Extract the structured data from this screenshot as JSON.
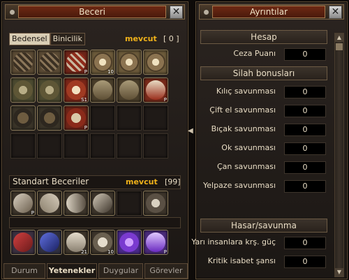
{
  "left_window": {
    "title": "Beceri",
    "close": "✕",
    "tabs": [
      "Bedensel",
      "Binicilik"
    ],
    "skills_section": {
      "available_label": "mevcut",
      "available_count": "[ 0 ]"
    },
    "skill_slots": [
      {
        "icon": "slash-icon",
        "badge": ""
      },
      {
        "icon": "slash-icon",
        "badge": ""
      },
      {
        "icon": "spiral-red-icon",
        "badge": "P"
      },
      {
        "icon": "starburst-icon",
        "badge": "10"
      },
      {
        "icon": "starburst-icon",
        "badge": ""
      },
      {
        "icon": "starburst-icon",
        "badge": ""
      },
      {
        "icon": "fan-icon",
        "badge": ""
      },
      {
        "icon": "fan-icon",
        "badge": ""
      },
      {
        "icon": "red-star-icon",
        "badge": "S1"
      },
      {
        "icon": "tree-icon",
        "badge": ""
      },
      {
        "icon": "tree-icon",
        "badge": ""
      },
      {
        "icon": "red-tree-icon",
        "badge": "P"
      },
      {
        "icon": "swirl-icon",
        "badge": ""
      },
      {
        "icon": "swirl-icon",
        "badge": ""
      },
      {
        "icon": "red-swirl-icon",
        "badge": "P"
      },
      {
        "icon": "empty",
        "badge": ""
      },
      {
        "icon": "empty",
        "badge": ""
      },
      {
        "icon": "empty",
        "badge": ""
      },
      {
        "icon": "empty",
        "badge": ""
      },
      {
        "icon": "empty",
        "badge": ""
      },
      {
        "icon": "empty",
        "badge": ""
      },
      {
        "icon": "empty",
        "badge": ""
      },
      {
        "icon": "empty",
        "badge": ""
      },
      {
        "icon": "empty",
        "badge": ""
      }
    ],
    "standard_section": {
      "title": "Standart Beceriler",
      "available_label": "mevcut",
      "available_count": "[99]"
    },
    "standard_skills": [
      {
        "icon": "scroll-icon",
        "badge": "P"
      },
      {
        "icon": "rope-icon",
        "badge": ""
      },
      {
        "icon": "flag-icon",
        "badge": ""
      },
      {
        "icon": "pickaxe-icon",
        "badge": ""
      },
      {
        "icon": "empty",
        "badge": ""
      },
      {
        "icon": "knot-icon",
        "badge": ""
      }
    ],
    "bottom_skills": [
      {
        "icon": "red-gem-icon",
        "badge": ""
      },
      {
        "icon": "blue-gem-icon",
        "badge": ""
      },
      {
        "icon": "horse-icon",
        "badge": "21"
      },
      {
        "icon": "dragon-icon",
        "badge": "10"
      },
      {
        "icon": "heart-icon",
        "badge": ""
      },
      {
        "icon": "dagger-icon",
        "badge": "P"
      }
    ],
    "bottom_tabs": [
      "Durum",
      "Yetenekler",
      "Duygular",
      "Görevler"
    ]
  },
  "right_window": {
    "title": "Ayrıntılar",
    "close": "✕",
    "sections": {
      "hesap": "Hesap",
      "silah": "Silah bonusları",
      "hasar": "Hasar/savunma"
    },
    "rows": {
      "ceza": {
        "label": "Ceza Puanı",
        "value": "0"
      },
      "kilic": {
        "label": "Kılıç savunması",
        "value": "0"
      },
      "cift": {
        "label": "Çift el savunması",
        "value": "0"
      },
      "bicak": {
        "label": "Bıçak savunması",
        "value": "0"
      },
      "ok": {
        "label": "Ok savunması",
        "value": "0"
      },
      "can": {
        "label": "Çan savunması",
        "value": "0"
      },
      "yelpaze": {
        "label": "Yelpaze savunması",
        "value": "0"
      },
      "yari": {
        "label": "Yarı insanlara krş. güç",
        "value": "0"
      },
      "kritik": {
        "label": "Kritik isabet şansı",
        "value": "0"
      }
    }
  }
}
